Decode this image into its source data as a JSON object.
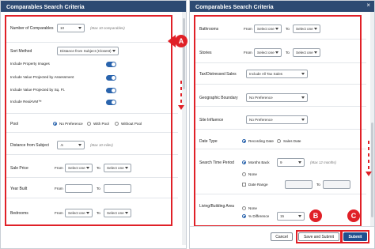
{
  "left_panel": {
    "title": "Comparables Search Criteria",
    "number_of_comparables": {
      "label": "Number of Comparables",
      "value": "10",
      "note": "(Max 10 comparables)"
    },
    "sort_method": {
      "label": "Sort Method",
      "value": "Distance from Subject (Closest)"
    },
    "toggles": [
      {
        "label": "Include Property Images",
        "on": true
      },
      {
        "label": "Include Value Projected by Assessment",
        "on": true
      },
      {
        "label": "Include Value Projected by Sq. Ft.",
        "on": true
      },
      {
        "label": "Include RealAVM™",
        "on": true
      }
    ],
    "pool": {
      "label": "Pool",
      "options": [
        "No Preference",
        "With Pool",
        "Without Pool"
      ],
      "selected": "No Preference"
    },
    "distance": {
      "label": "Distance from Subject",
      "value": ".5",
      "note": "(Max 10 miles)"
    },
    "sale_price": {
      "label": "Sale Price",
      "from_label": "From",
      "from_value": "Select one",
      "to_label": "To",
      "to_value": "Select one"
    },
    "year_built": {
      "label": "Year Built",
      "from_label": "From",
      "to_label": "To"
    },
    "bedrooms": {
      "label": "Bedrooms",
      "from_label": "From",
      "from_value": "Select one",
      "to_label": "To",
      "to_value": "Select one"
    }
  },
  "right_panel": {
    "title": "Comparables Search Criteria",
    "bathrooms": {
      "label": "Bathrooms",
      "from_label": "From",
      "from_value": "Select one",
      "to_label": "To",
      "to_value": "Select one"
    },
    "stories": {
      "label": "Stories",
      "from_label": "From",
      "from_value": "Select one",
      "to_label": "To",
      "to_value": "Select one"
    },
    "tax_distressed": {
      "label": "Tax/Distressed Sales",
      "value": "Include All Tax Sales"
    },
    "geo_boundary": {
      "label": "Geographic Boundary",
      "value": "No Preference"
    },
    "site_influence": {
      "label": "Site Influence",
      "value": "No Preference"
    },
    "date_type": {
      "label": "Date Type",
      "options": [
        "Recording Date",
        "Sales Date"
      ],
      "selected": "Recording Date"
    },
    "search_time_period": {
      "label": "Search Time Period",
      "months_back_label": "Months Back",
      "months_back_value": "9",
      "note": "(Max 12 months)",
      "none_label": "None",
      "date_range_label": "Date Range",
      "date_range_to_label": "To"
    },
    "living_area": {
      "label": "Living/Building Area",
      "none_label": "None",
      "pct_label": "% Difference",
      "pct_value": "15"
    },
    "buttons": {
      "cancel": "Cancel",
      "save_submit": "Save and Submit",
      "submit": "Submit"
    }
  },
  "annotations": {
    "a": "A",
    "b": "B",
    "c": "C"
  },
  "colors": {
    "header": "#2d4a72",
    "accent": "#2a64ad",
    "annotation_red": "#e02027",
    "primary_button": "#1f4f8f"
  }
}
